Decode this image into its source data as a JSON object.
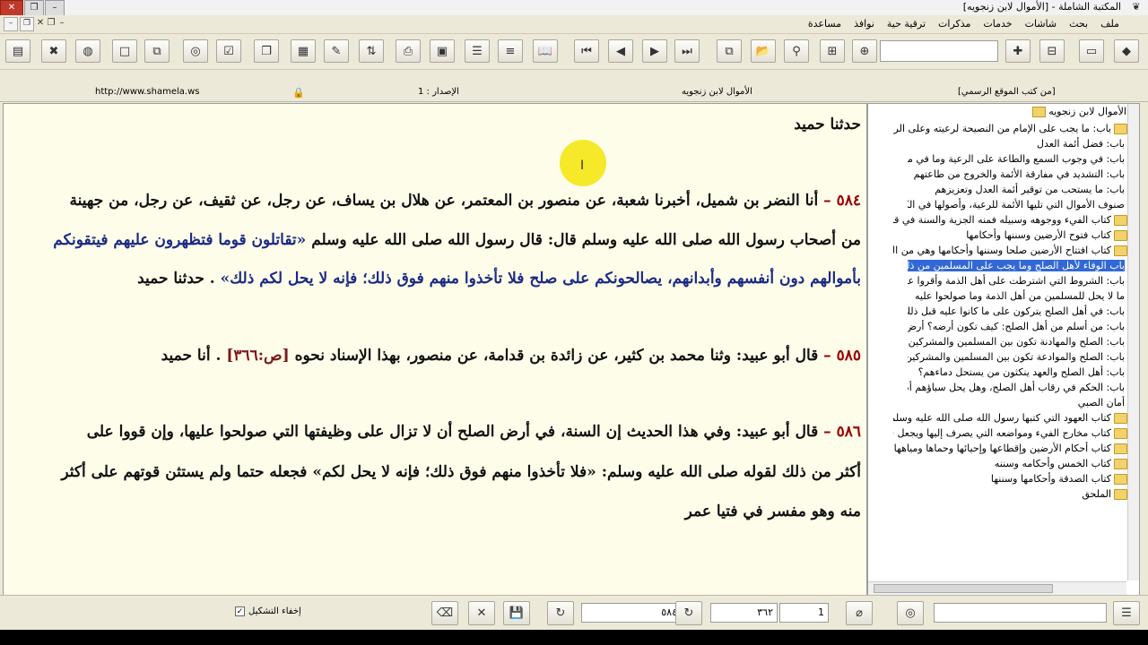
{
  "window": {
    "title": "المكتبة الشاملة - [الأموال لابن زنجويه]",
    "minimize_glyph": "–",
    "restore_glyph": "❐",
    "close_glyph": "✕"
  },
  "mdi_controls": [
    "-",
    "a",
    "x",
    "a",
    "-"
  ],
  "menu": [
    "ملف",
    "بحث",
    "شاشات",
    "خدمات",
    "مذكرات",
    "ترقية حية",
    "نوافذ",
    "مساعدة"
  ],
  "toolbar_icons": [
    "library-icon",
    "tools-icon",
    "refresh-book-icon",
    "new-page-icon",
    "copy-page-icon",
    "binoculars-icon",
    "check-doc-icon",
    "copy-icon",
    "doc-icon",
    "export-icon",
    "pencil-icon",
    "sort-icon",
    "print-icon",
    "disabled-icon",
    "list-icon",
    "lines-icon",
    "open-book-icon",
    "first-icon",
    "prev-icon",
    "next-icon",
    "last-icon",
    "windows-icon",
    "folder-open-icon",
    "find-icon",
    "page-find-icon",
    "zoom-icon"
  ],
  "toolbar_right_icons": [
    "add-note-icon",
    "tree-icon",
    "book-icon",
    "books-icon"
  ],
  "status": {
    "website": "http://www.shamela.ws",
    "version": "الإصدار : 1",
    "book_title": "الأموال لابن زنجويه",
    "source": "[من كتب الموقع الرسمي]"
  },
  "content": {
    "heading": "حدثنا حميد",
    "p1_num": "٥٨٤ –",
    "p1_line1": "أنا النضر بن شميل، أخبرنا شعبة، عن منصور بن المعتمر، عن هلال بن يساف، عن رجل، عن ثقيف، عن رجل، من جهينة",
    "p1_line2a": "من أصحاب رسول الله صلى الله عليه وسلم قال: قال رسول الله صلى الله عليه وسلم ",
    "p1_line2b": "«تقاتلون قوما فتظهرون عليهم فيتقونكم",
    "p1_line3a": "بأموالهم دون أنفسهم وأبدانهم، يصالحونكم على صلح فلا تأخذوا منهم فوق ذلك؛ فإنه لا يحل لكم ذلك»",
    "p1_line3b": " . حدثنا حميد",
    "p2_num": "٥٨٥ –",
    "p2_text": "قال أبو عبيد: وثنا محمد بن كثير، عن زائدة بن قدامة، عن منصور، بهذا الإسناد نحوه ",
    "p2_page": "[ص:٣٦٦]",
    "p2_end": ". أنا حميد",
    "p3_num": "٥٨٦ –",
    "p3_line1": "قال أبو عبيد: وفي هذا الحديث إن السنة، في أرض الصلح أن لا تزال على وظيفتها التي صولحوا عليها، وإن قووا على",
    "p3_line2": "أكثر من ذلك لقوله صلى الله عليه وسلم: «فلا تأخذوا منهم فوق ذلك؛ فإنه لا يحل لكم» فجعله حتما ولم يستثن قوتهم على أكثر",
    "p3_line3": "منه وهو مفسر في فتيا عمر"
  },
  "tree": {
    "root": "الأموال لابن زنجويه",
    "rows": [
      {
        "label": "باب: ما يجب على الإمام من النصيحة لرعيته وعلى الرعية لإمامهم",
        "type": "folder",
        "expand": "−"
      },
      {
        "label": "باب: فضل أئمة العدل",
        "type": "leaf"
      },
      {
        "label": "باب: في وجوب السمع والطاعة على الرعية وما في منازعتهم",
        "type": "leaf"
      },
      {
        "label": "باب: التشديد في مفارقة الأئمة والخروج من طاعتهم",
        "type": "leaf"
      },
      {
        "label": "باب: ما يستحب من توقير أئمة العدل وتعزيزهم",
        "type": "leaf"
      },
      {
        "label": "صنوف الأموال التي تليها الأئمة للرعية، وأصولها في الكتاب والسنة",
        "type": "leaf"
      },
      {
        "label": "كتاب الفيء ووجوهه وسبيله فمنه الجزية والسنة في قبولها والعمل بها",
        "type": "folder",
        "expand": "+"
      },
      {
        "label": "كتاب فتوح الأرضين وسننها وأحكامها",
        "type": "folder",
        "expand": "+"
      },
      {
        "label": "كتاب افتتاح الأرضين صلحا وسننها وأحكامها وهي من الفيء",
        "type": "folder",
        "expand": "−"
      },
      {
        "label": "باب الوفاء لأهل الصلح وما يجب على المسلمين من ذلك",
        "type": "leaf",
        "selected": true
      },
      {
        "label": "باب: الشروط التي اشترطت على أهل الذمة وأقروا على دينهم",
        "type": "leaf"
      },
      {
        "label": "ما لا يحل للمسلمين من أهل الذمة وما صولحوا عليه",
        "type": "leaf"
      },
      {
        "label": "باب: في أهل الصلح يتركون على ما كانوا عليه قبل ذلك",
        "type": "leaf"
      },
      {
        "label": "باب: من أسلم من أهل الصلح: كيف تكون أرضه؟ أرض عشر أم خراج",
        "type": "leaf"
      },
      {
        "label": "باب: الصلح والمهادنة تكون بين المسلمين والمشركين إلى مدة",
        "type": "leaf"
      },
      {
        "label": "باب: الصلح والموادعة تكون بين المسلمين والمشركين إلى غير مدة",
        "type": "leaf"
      },
      {
        "label": "باب: أهل الصلح والعهد ينكثون من يستحل دماءهم؟",
        "type": "leaf"
      },
      {
        "label": "باب: الحكم في رقاب أهل الصلح، وهل يحل سباؤهم أم لا",
        "type": "leaf"
      },
      {
        "label": "أمان الصبي",
        "type": "leaf"
      },
      {
        "label": "كتاب العهود التي كتبها رسول الله صلى الله عليه وسلم وأصحابه",
        "type": "folder",
        "expand": "+"
      },
      {
        "label": "كتاب مخارج الفيء ومواضعه التي يصرف إليها ويجعل فيها",
        "type": "folder",
        "expand": "+"
      },
      {
        "label": "كتاب أحكام الأرضين وإقطاعها وإحيائها وحماها ومياهها",
        "type": "folder",
        "expand": "+"
      },
      {
        "label": "كتاب الخمس وأحكامه وسننه",
        "type": "folder",
        "expand": "+"
      },
      {
        "label": "كتاب الصدقة وأحكامها وسننها",
        "type": "folder",
        "expand": "+"
      },
      {
        "label": "الملحق",
        "type": "folder",
        "expand": ""
      }
    ]
  },
  "bottom": {
    "hide_diacritics_label": "إخفاء التشكيل",
    "hide_diacritics_checked": "✓",
    "hadith_number": "٥٨٤",
    "page_number": "٣٦٢",
    "part_number": "1"
  }
}
